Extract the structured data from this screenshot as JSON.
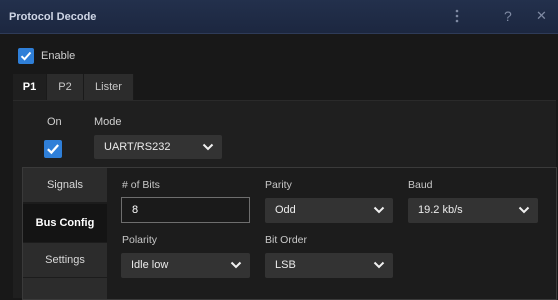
{
  "window": {
    "title": "Protocol Decode",
    "icons": [
      "more-vertical-icon",
      "help-icon",
      "close-icon"
    ],
    "help_glyph": "?",
    "close_glyph": "✕"
  },
  "enable": {
    "label": "Enable",
    "checked": true
  },
  "tabs": [
    {
      "label": "P1",
      "active": true
    },
    {
      "label": "P2",
      "active": false
    },
    {
      "label": "Lister",
      "active": false
    }
  ],
  "on": {
    "label": "On",
    "checked": true
  },
  "mode": {
    "label": "Mode",
    "value": "UART/RS232"
  },
  "sidebar": [
    {
      "label": "Signals",
      "active": false
    },
    {
      "label": "Bus Config",
      "active": true
    },
    {
      "label": "Settings",
      "active": false
    }
  ],
  "bus_config": {
    "bits": {
      "label": "# of Bits",
      "value": "8"
    },
    "parity": {
      "label": "Parity",
      "value": "Odd"
    },
    "baud": {
      "label": "Baud",
      "value": "19.2 kb/s"
    },
    "polarity": {
      "label": "Polarity",
      "value": "Idle low"
    },
    "bit_order": {
      "label": "Bit Order",
      "value": "LSB"
    }
  },
  "colors": {
    "accent": "#2f7fd8",
    "titlebar": "#1c2740",
    "panel": "#181818"
  }
}
